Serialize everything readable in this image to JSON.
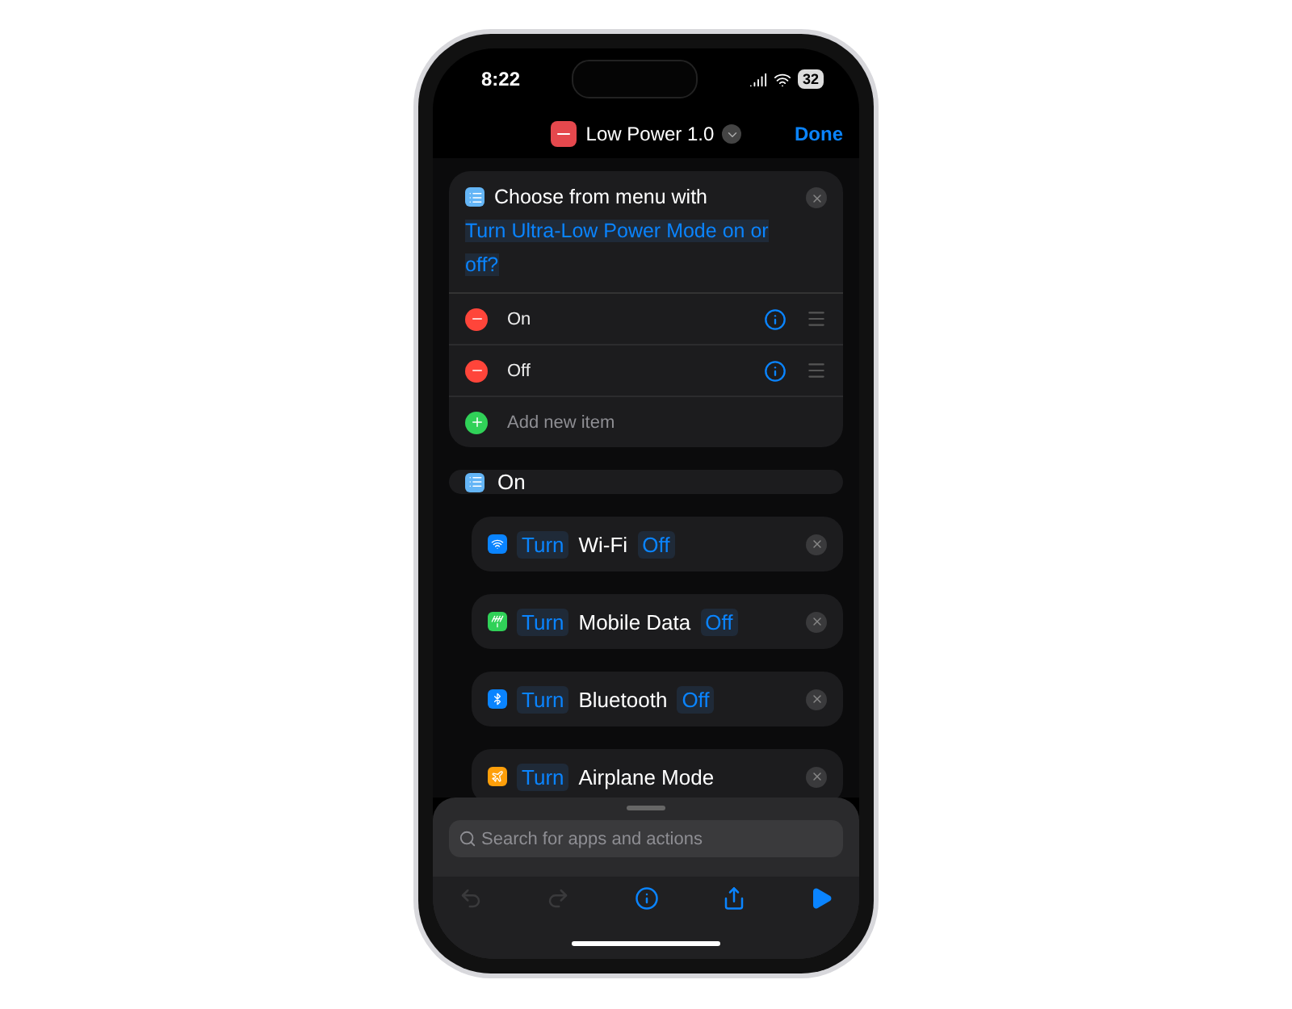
{
  "status_bar": {
    "time": "8:22",
    "battery": "32"
  },
  "nav": {
    "title": "Low Power 1.0",
    "done": "Done"
  },
  "menu_card": {
    "title": "Choose from menu with",
    "prompt": "Turn Ultra-Low Power Mode on or off?",
    "items": [
      {
        "kind": "remove",
        "label": "On"
      },
      {
        "kind": "remove",
        "label": "Off"
      },
      {
        "kind": "add",
        "label": "Add new item"
      }
    ]
  },
  "section": {
    "label": "On"
  },
  "actions": [
    {
      "color": "#0a84ff",
      "verb": "Turn",
      "name": "Wi-Fi",
      "value": "Off"
    },
    {
      "color": "#30d158",
      "verb": "Turn",
      "name": "Mobile Data",
      "value": "Off"
    },
    {
      "color": "#0a84ff",
      "verb": "Turn",
      "name": "Bluetooth",
      "value": "Off"
    },
    {
      "color": "#ff9f0a",
      "verb": "Turn",
      "name": "Airplane Mode"
    }
  ],
  "search": {
    "placeholder": "Search for apps and actions"
  },
  "toolbar": [
    {
      "disabled": true
    },
    {
      "disabled": true
    },
    {
      "disabled": false
    },
    {
      "disabled": false
    },
    {
      "disabled": false
    }
  ]
}
